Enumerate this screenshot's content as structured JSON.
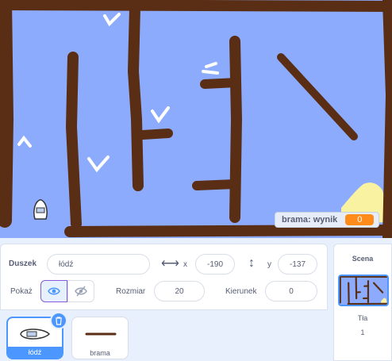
{
  "stage": {
    "monitor": {
      "label": "brama: wynik",
      "value": "0"
    },
    "colors": {
      "water": "#8cabfc",
      "wall": "#5a2e14",
      "sand": "#f9f2a0"
    }
  },
  "sprite_info": {
    "sprite_label": "Duszek",
    "sprite_name": "łódź",
    "x_label": "x",
    "x_value": "-190",
    "y_label": "y",
    "y_value": "-137",
    "show_label": "Pokaż",
    "size_label": "Rozmiar",
    "size_value": "20",
    "direction_label": "Kierunek",
    "direction_value": "0"
  },
  "sprites": [
    {
      "name": "łódź",
      "selected": true
    },
    {
      "name": "brama",
      "selected": false
    }
  ],
  "scene": {
    "title": "Scena",
    "backdrops_label": "Tła",
    "backdrops_count": "1"
  },
  "icons": [
    "horizontal-arrows-icon",
    "vertical-arrows-icon",
    "eye-icon",
    "eye-slash-icon",
    "trash-icon",
    "boat-icon",
    "gate-icon"
  ],
  "accent": "#4c97ff"
}
